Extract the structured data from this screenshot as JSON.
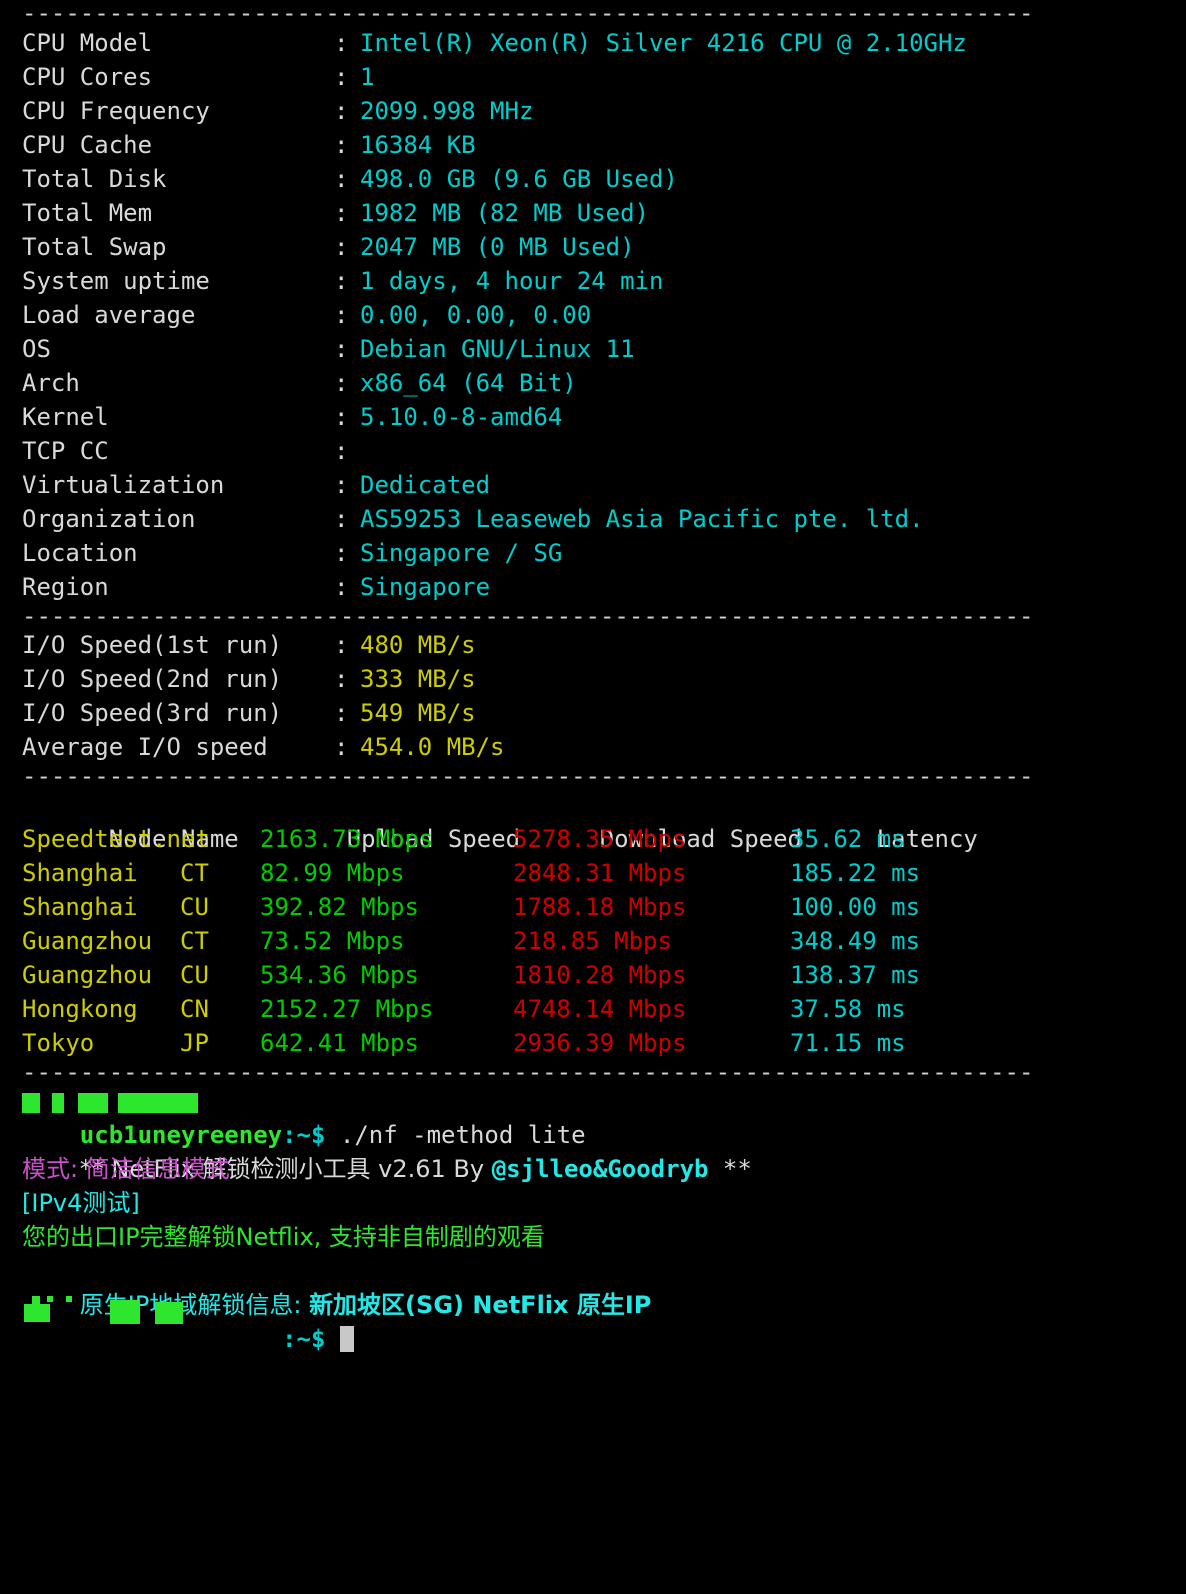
{
  "terminal": {
    "background": "#000000",
    "separator": "----------------------------------------------------------------------",
    "colors": {
      "label": "#d9d9d9",
      "value_cyan": "#00cdcd",
      "value_yellow": "#cdcd00",
      "upload_green": "#00cd00",
      "download_red": "#cd0000",
      "latency_cyan": "#00cdcd",
      "magenta": "#cd4fcd",
      "bright_green": "#2ee62e",
      "bright_cyan": "#24e8e8",
      "cursor": "#c8c8c8"
    }
  },
  "system_info": {
    "rows": [
      {
        "key": "CPU Model",
        "colon": ":",
        "value": "Intel(R) Xeon(R) Silver 4216 CPU @ 2.10GHz"
      },
      {
        "key": "CPU Cores",
        "colon": ":",
        "value": "1"
      },
      {
        "key": "CPU Frequency",
        "colon": ":",
        "value": "2099.998 MHz"
      },
      {
        "key": "CPU Cache",
        "colon": ":",
        "value": "16384 KB"
      },
      {
        "key": "Total Disk",
        "colon": ":",
        "value": "498.0 GB (9.6 GB Used)"
      },
      {
        "key": "Total Mem",
        "colon": ":",
        "value": "1982 MB (82 MB Used)"
      },
      {
        "key": "Total Swap",
        "colon": ":",
        "value": "2047 MB (0 MB Used)"
      },
      {
        "key": "System uptime",
        "colon": ":",
        "value": "1 days, 4 hour 24 min"
      },
      {
        "key": "Load average",
        "colon": ":",
        "value": "0.00, 0.00, 0.00"
      },
      {
        "key": "OS",
        "colon": ":",
        "value": "Debian GNU/Linux 11"
      },
      {
        "key": "Arch",
        "colon": ":",
        "value": "x86_64 (64 Bit)"
      },
      {
        "key": "Kernel",
        "colon": ":",
        "value": "5.10.0-8-amd64"
      },
      {
        "key": "TCP CC",
        "colon": ":",
        "value": ""
      },
      {
        "key": "Virtualization",
        "colon": ":",
        "value": "Dedicated"
      },
      {
        "key": "Organization",
        "colon": ":",
        "value": "AS59253 Leaseweb Asia Pacific pte. ltd."
      },
      {
        "key": "Location",
        "colon": ":",
        "value": "Singapore / SG"
      },
      {
        "key": "Region",
        "colon": ":",
        "value": "Singapore"
      }
    ]
  },
  "io_speed": {
    "rows": [
      {
        "key": "I/O Speed(1st run)",
        "colon": ":",
        "value": "480 MB/s"
      },
      {
        "key": "I/O Speed(2nd run)",
        "colon": ":",
        "value": "333 MB/s"
      },
      {
        "key": "I/O Speed(3rd run)",
        "colon": ":",
        "value": "549 MB/s"
      },
      {
        "key": "Average I/O speed",
        "colon": ":",
        "value": "454.0 MB/s"
      }
    ]
  },
  "speedtest": {
    "headers": {
      "node": "Node Name",
      "upload": "Upload Speed",
      "download": "Download Speed",
      "latency": "Latency"
    },
    "rows": [
      {
        "node": "Speedtest.net",
        "isp": "",
        "upload": "2163.73 Mbps",
        "download": "5278.35 Mbps",
        "latency": "35.62 ms"
      },
      {
        "node": "Shanghai",
        "isp": "CT",
        "upload": "82.99 Mbps",
        "download": "2848.31 Mbps",
        "latency": "185.22 ms"
      },
      {
        "node": "Shanghai",
        "isp": "CU",
        "upload": "392.82 Mbps",
        "download": "1788.18 Mbps",
        "latency": "100.00 ms"
      },
      {
        "node": "Guangzhou",
        "isp": "CT",
        "upload": "73.52 Mbps",
        "download": "218.85 Mbps",
        "latency": "348.49 ms"
      },
      {
        "node": "Guangzhou",
        "isp": "CU",
        "upload": "534.36 Mbps",
        "download": "1810.28 Mbps",
        "latency": "138.37 ms"
      },
      {
        "node": "Hongkong",
        "isp": "CN",
        "upload": "2152.27 Mbps",
        "download": "4748.14 Mbps",
        "latency": "37.58 ms"
      },
      {
        "node": "Tokyo",
        "isp": "JP",
        "upload": "642.41 Mbps",
        "download": "2936.39 Mbps",
        "latency": "71.15 ms"
      }
    ]
  },
  "netflix_check": {
    "prompt_user": "ucb1uneyreeney",
    "prompt_suffix": ":~$",
    "command": " ./nf -method lite",
    "banner_prefix": "** NetFlix 解锁检测小工具 v2.61 By ",
    "banner_author": "@sjlleo&Goodryb",
    "banner_suffix": " **",
    "mode_line": "模式: 简洁信息模式",
    "test_header": "[IPv4测试]",
    "unlock_result": "您的出口IP完整解锁Netflix, 支持非自制剧的观看",
    "native_label": "原生IP地域解锁信息: ",
    "native_value": "新加坡区(SG) NetFlix 原生IP"
  },
  "final_prompt": {
    "suffix": ":~$",
    "cursor": "block"
  }
}
